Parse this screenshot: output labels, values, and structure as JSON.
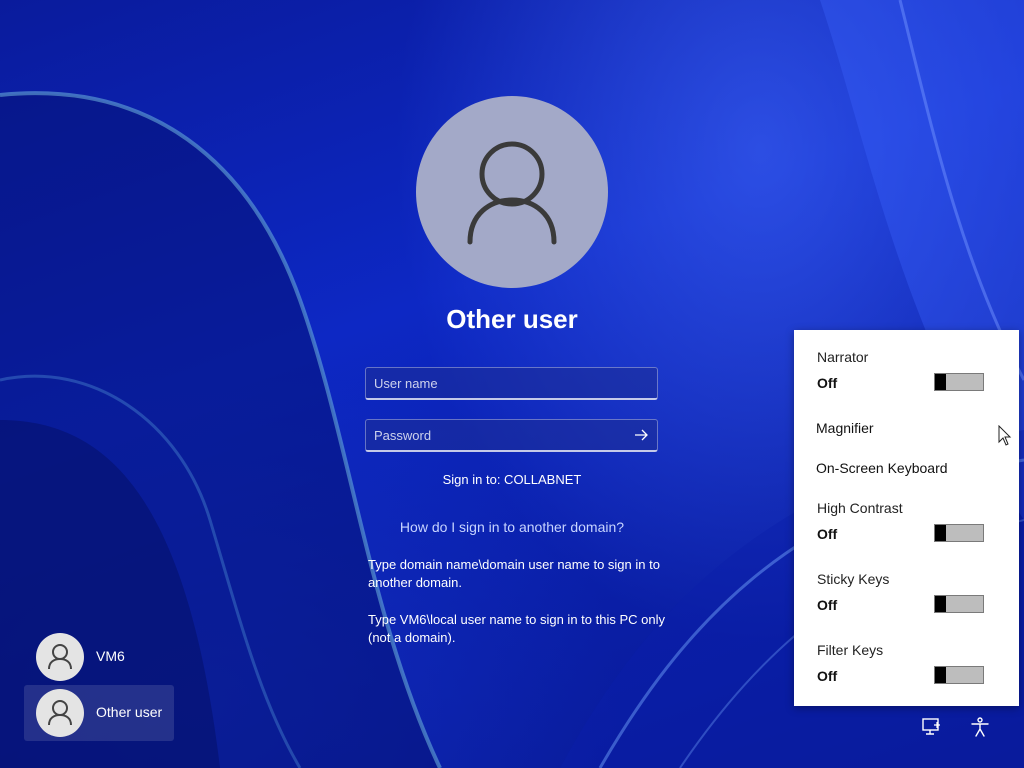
{
  "user": {
    "display_name": "Other user"
  },
  "form": {
    "username_placeholder": "User name",
    "password_placeholder": "Password",
    "sign_in_to": "Sign in to: COLLABNET",
    "help_link": "How do I sign in to another domain?",
    "help_text_1": "Type domain name\\domain user name to sign in to another domain.",
    "help_text_2": "Type VM6\\local user name to sign in to this PC only (not a domain)."
  },
  "user_switcher": [
    {
      "label": "VM6",
      "selected": false
    },
    {
      "label": "Other user",
      "selected": true
    }
  ],
  "accessibility_panel": {
    "narrator": {
      "label": "Narrator",
      "state": "Off"
    },
    "magnifier": {
      "label": "Magnifier"
    },
    "on_screen_keyboard": {
      "label": "On-Screen Keyboard"
    },
    "high_contrast": {
      "label": "High Contrast",
      "state": "Off"
    },
    "sticky_keys": {
      "label": "Sticky Keys",
      "state": "Off"
    },
    "filter_keys": {
      "label": "Filter Keys",
      "state": "Off"
    }
  },
  "tray_icons": [
    "network-icon",
    "accessibility-icon"
  ],
  "colors": {
    "background": "#0b1ea8",
    "avatar": "#a3a9c8",
    "panel": "#ffffff"
  }
}
